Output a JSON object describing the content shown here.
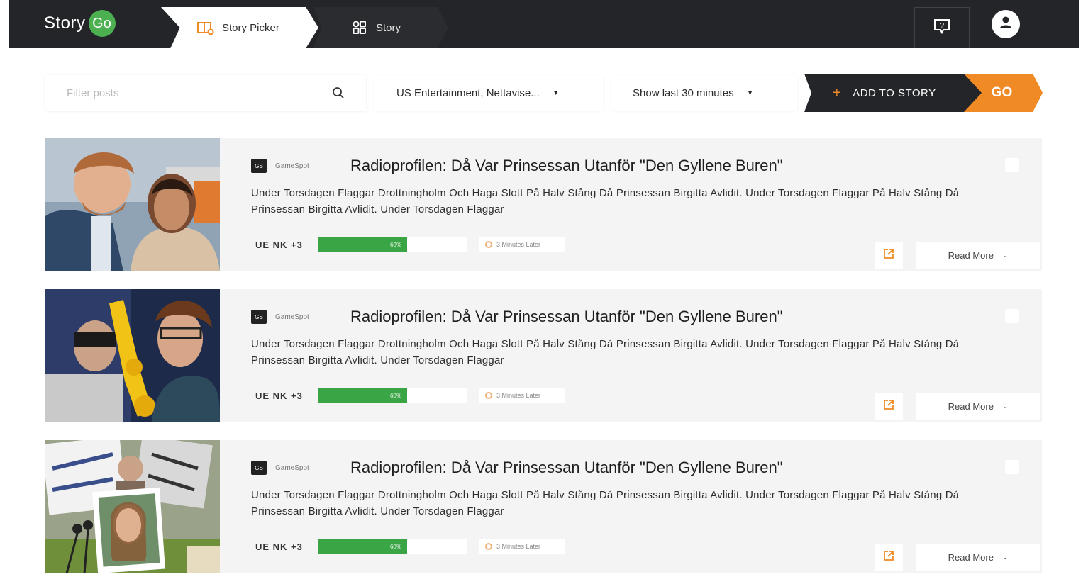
{
  "header": {
    "logo_text": "Story",
    "logo_badge": "Go",
    "tabs": [
      {
        "label": "Story Picker",
        "icon": "book-open-icon",
        "active": true
      },
      {
        "label": "Story",
        "icon": "grid-icon",
        "active": false
      }
    ],
    "help_icon": "help-icon",
    "avatar_icon": "user-icon"
  },
  "filters": {
    "search_placeholder": "Filter posts",
    "source_select": "US Entertainment, Nettavise...",
    "time_select": "Show last 30 minutes",
    "add_label": "ADD TO STORY",
    "go_label": "GO"
  },
  "colors": {
    "topbar": "#232528",
    "accent_orange": "#f08a24",
    "accent_green": "#3aa544"
  },
  "stories": [
    {
      "source_logo": "GS",
      "source": "GameSpot",
      "title": "Radioprofilen: Då Var Prinsessan Utanför \"Den Gyllene Buren\"",
      "summary": "Under Torsdagen Flaggar Drottningholm Och Haga Slott På Halv Stång Då Prinsessan Birgitta Avlidit. Under Torsdagen Flaggar På Halv Stång Då Prinsessan Birgitta Avlidit. Under Torsdagen Flaggar",
      "tag": "UE NK +3",
      "progress": 0.6,
      "progress_label": "60%",
      "time": "3 Minutes Later",
      "read_more": "Read More"
    },
    {
      "source_logo": "GS",
      "source": "GameSpot",
      "title": "Radioprofilen: Då Var Prinsessan Utanför \"Den Gyllene Buren\"",
      "summary": "Under Torsdagen Flaggar Drottningholm Och Haga Slott På Halv Stång Då Prinsessan Birgitta Avlidit. Under Torsdagen Flaggar På Halv Stång Då Prinsessan Birgitta Avlidit. Under Torsdagen Flaggar",
      "tag": "UE NK +3",
      "progress": 0.6,
      "progress_label": "60%",
      "time": "3 Minutes Later",
      "read_more": "Read More"
    },
    {
      "source_logo": "GS",
      "source": "GameSpot",
      "title": "Radioprofilen: Då Var Prinsessan Utanför \"Den Gyllene Buren\"",
      "summary": "Under Torsdagen Flaggar Drottningholm Och Haga Slott På Halv Stång Då Prinsessan Birgitta Avlidit. Under Torsdagen Flaggar På Halv Stång Då Prinsessan Birgitta Avlidit. Under Torsdagen Flaggar",
      "tag": "UE NK +3",
      "progress": 0.6,
      "progress_label": "60%",
      "time": "3 Minutes Later",
      "read_more": "Read More"
    }
  ]
}
